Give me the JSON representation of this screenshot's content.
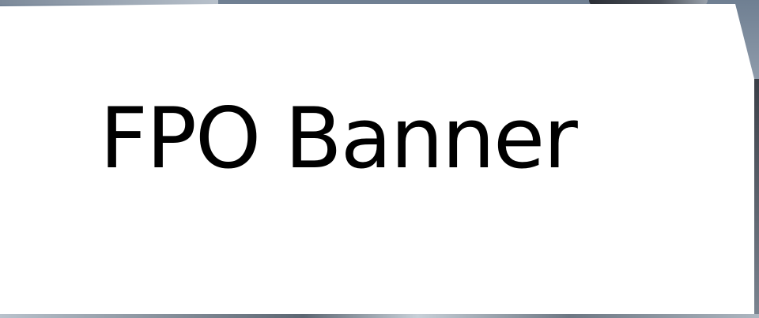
{
  "banner": {
    "text": "FPO Banner",
    "text_color": "#000000",
    "card_color": "#ffffff"
  }
}
